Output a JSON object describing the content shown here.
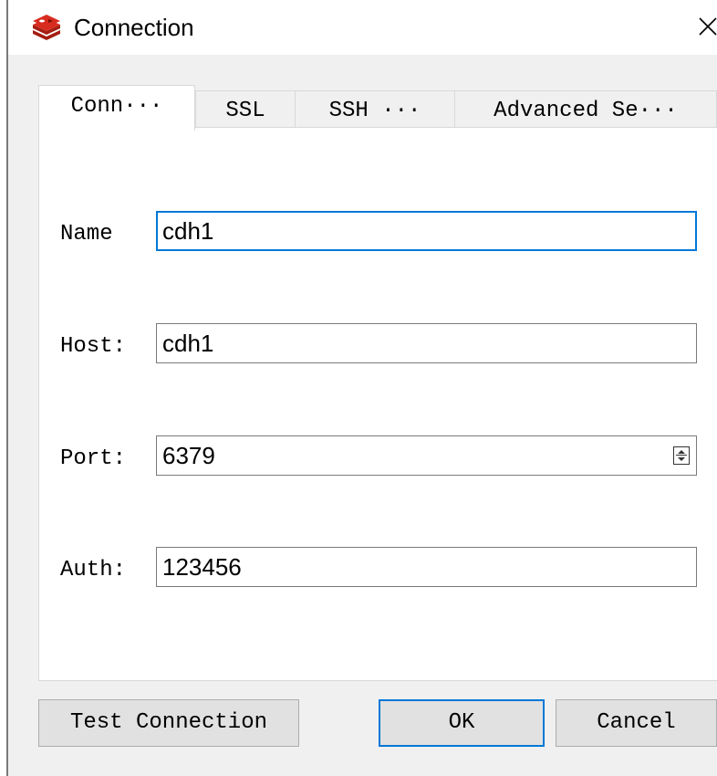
{
  "window": {
    "title": "Connection",
    "icon": "redis-logo-icon",
    "close_glyph": "✕",
    "accent_color": "#0078d7",
    "logo_color": "#d82c20"
  },
  "tabs": [
    {
      "label": "Conn···",
      "active": true
    },
    {
      "label": "SSL",
      "active": false
    },
    {
      "label": "SSH ···",
      "active": false
    },
    {
      "label": "Advanced Se···",
      "active": false
    }
  ],
  "form": {
    "name": {
      "label": "Name",
      "value": "cdh1"
    },
    "host": {
      "label": "Host:",
      "value": "cdh1"
    },
    "port": {
      "label": "Port:",
      "value": "6379"
    },
    "auth": {
      "label": "Auth:",
      "value": "123456"
    }
  },
  "buttons": {
    "test_connection": "Test Connection",
    "ok": "OK",
    "cancel": "Cancel"
  }
}
